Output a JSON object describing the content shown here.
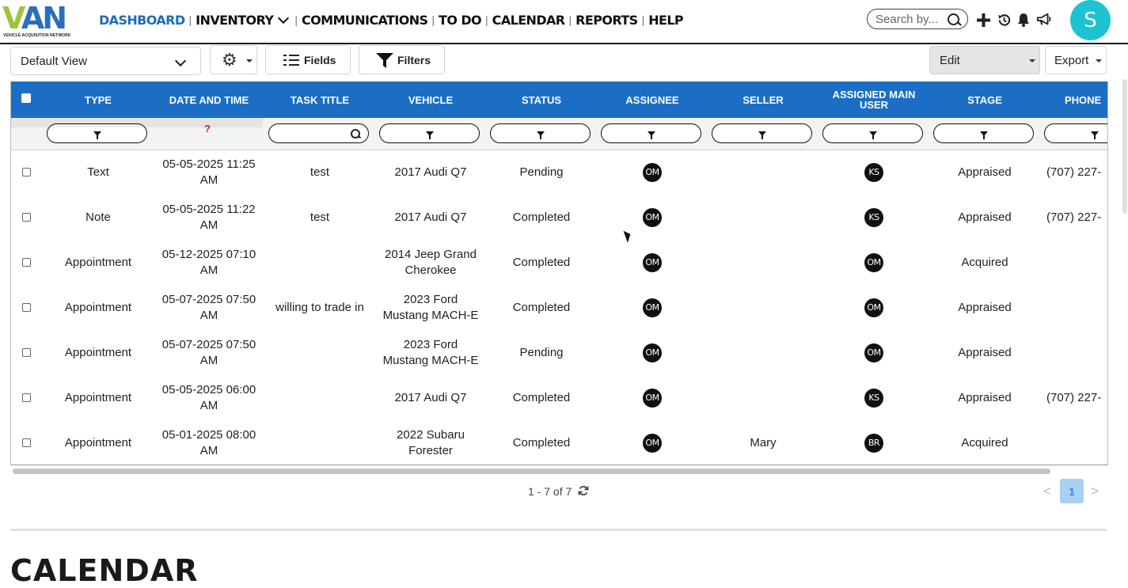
{
  "brand": {
    "logo_letters": [
      "V",
      "A",
      "N"
    ],
    "tagline": "VEHICLE ACQUISITION NETWORK",
    "colors": {
      "v": "#9bc53d",
      "an": "#2a6fb8"
    }
  },
  "nav": {
    "dashboard": "DASHBOARD",
    "inventory": "INVENTORY",
    "communications": "COMMUNICATIONS",
    "todo": "TO DO",
    "calendar": "CALENDAR",
    "reports": "REPORTS",
    "help": "HELP",
    "active_color": "#1f6db5"
  },
  "search": {
    "placeholder": "Search by..."
  },
  "user": {
    "initial": "S",
    "avatar_color": "#1ec3d3"
  },
  "toolbar": {
    "view": "Default View",
    "fields": "Fields",
    "filters": "Filters",
    "edit": "Edit",
    "export": "Export"
  },
  "table": {
    "header_color": "#1b6ec3",
    "columns": {
      "type": "TYPE",
      "date": "DATE AND TIME",
      "title": "TASK TITLE",
      "vehicle": "VEHICLE",
      "status": "STATUS",
      "assignee": "ASSIGNEE",
      "seller": "SELLER",
      "main_user_1": "ASSIGNED MAIN",
      "main_user_2": "USER",
      "stage": "STAGE",
      "phone": "PHONE"
    },
    "missing_filter_mark": "?",
    "rows": [
      {
        "type": "Text",
        "date1": "05-05-2025 11:25",
        "date2": "AM",
        "title": "test",
        "vehicle1": "2017 Audi Q7",
        "vehicle2": "",
        "status": "Pending",
        "assignee": "OM",
        "seller": "",
        "main_user": "KS",
        "stage": "Appraised",
        "phone": "(707) 227-"
      },
      {
        "type": "Note",
        "date1": "05-05-2025 11:22",
        "date2": "AM",
        "title": "test",
        "vehicle1": "2017 Audi Q7",
        "vehicle2": "",
        "status": "Completed",
        "assignee": "OM",
        "seller": "",
        "main_user": "KS",
        "stage": "Appraised",
        "phone": "(707) 227-"
      },
      {
        "type": "Appointment",
        "date1": "05-12-2025 07:10",
        "date2": "AM",
        "title": "",
        "vehicle1": "2014 Jeep Grand",
        "vehicle2": "Cherokee",
        "status": "Completed",
        "assignee": "OM",
        "seller": "",
        "main_user": "OM",
        "stage": "Acquired",
        "phone": ""
      },
      {
        "type": "Appointment",
        "date1": "05-07-2025 07:50",
        "date2": "AM",
        "title": "willing to trade in",
        "vehicle1": "2023 Ford",
        "vehicle2": "Mustang MACH-E",
        "status": "Completed",
        "assignee": "OM",
        "seller": "",
        "main_user": "OM",
        "stage": "Appraised",
        "phone": ""
      },
      {
        "type": "Appointment",
        "date1": "05-07-2025 07:50",
        "date2": "AM",
        "title": "",
        "vehicle1": "2023 Ford",
        "vehicle2": "Mustang MACH-E",
        "status": "Pending",
        "assignee": "OM",
        "seller": "",
        "main_user": "OM",
        "stage": "Appraised",
        "phone": ""
      },
      {
        "type": "Appointment",
        "date1": "05-05-2025 06:00",
        "date2": "AM",
        "title": "",
        "vehicle1": "2017 Audi Q7",
        "vehicle2": "",
        "status": "Completed",
        "assignee": "OM",
        "seller": "",
        "main_user": "KS",
        "stage": "Appraised",
        "phone": "(707) 227-"
      },
      {
        "type": "Appointment",
        "date1": "05-01-2025 08:00",
        "date2": "AM",
        "title": "",
        "vehicle1": "2022 Subaru",
        "vehicle2": "Forester",
        "status": "Completed",
        "assignee": "OM",
        "seller": "Mary",
        "main_user": "BR",
        "stage": "Acquired",
        "phone": ""
      }
    ]
  },
  "pager": {
    "info": "1 - 7 of 7",
    "prev": "<",
    "current": "1",
    "next": ">"
  },
  "next_section": {
    "title": "CALENDAR"
  }
}
